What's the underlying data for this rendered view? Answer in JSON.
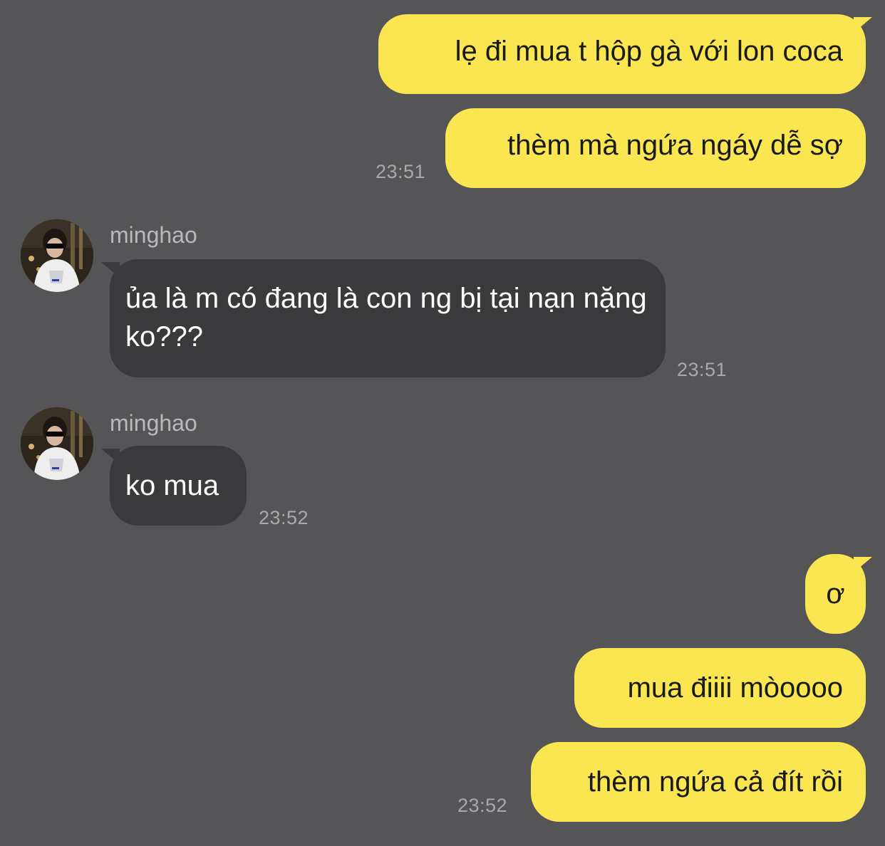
{
  "chat": {
    "messages": [
      {
        "from": "me",
        "text": "lẹ đi mua t hộp gà với lon coca"
      },
      {
        "from": "me",
        "text": "thèm mà ngứa ngáy dễ sợ",
        "time": "23:51"
      },
      {
        "from": "minghao",
        "sender": "minghao",
        "text": "ủa là m có đang là con ng bị tại nạn nặng ko???",
        "time": "23:51"
      },
      {
        "from": "minghao",
        "sender": "minghao",
        "text": "ko mua",
        "time": "23:52"
      },
      {
        "from": "me",
        "text": "ơ"
      },
      {
        "from": "me",
        "text": "mua điiii mòoooo"
      },
      {
        "from": "me",
        "text": "thèm ngứa cả đít rồi",
        "time": "23:52"
      }
    ]
  },
  "colors": {
    "background": "#555456",
    "outgoing_bubble": "#f9e650",
    "incoming_bubble": "#3a393b",
    "timestamp": "#a9a8aa"
  }
}
